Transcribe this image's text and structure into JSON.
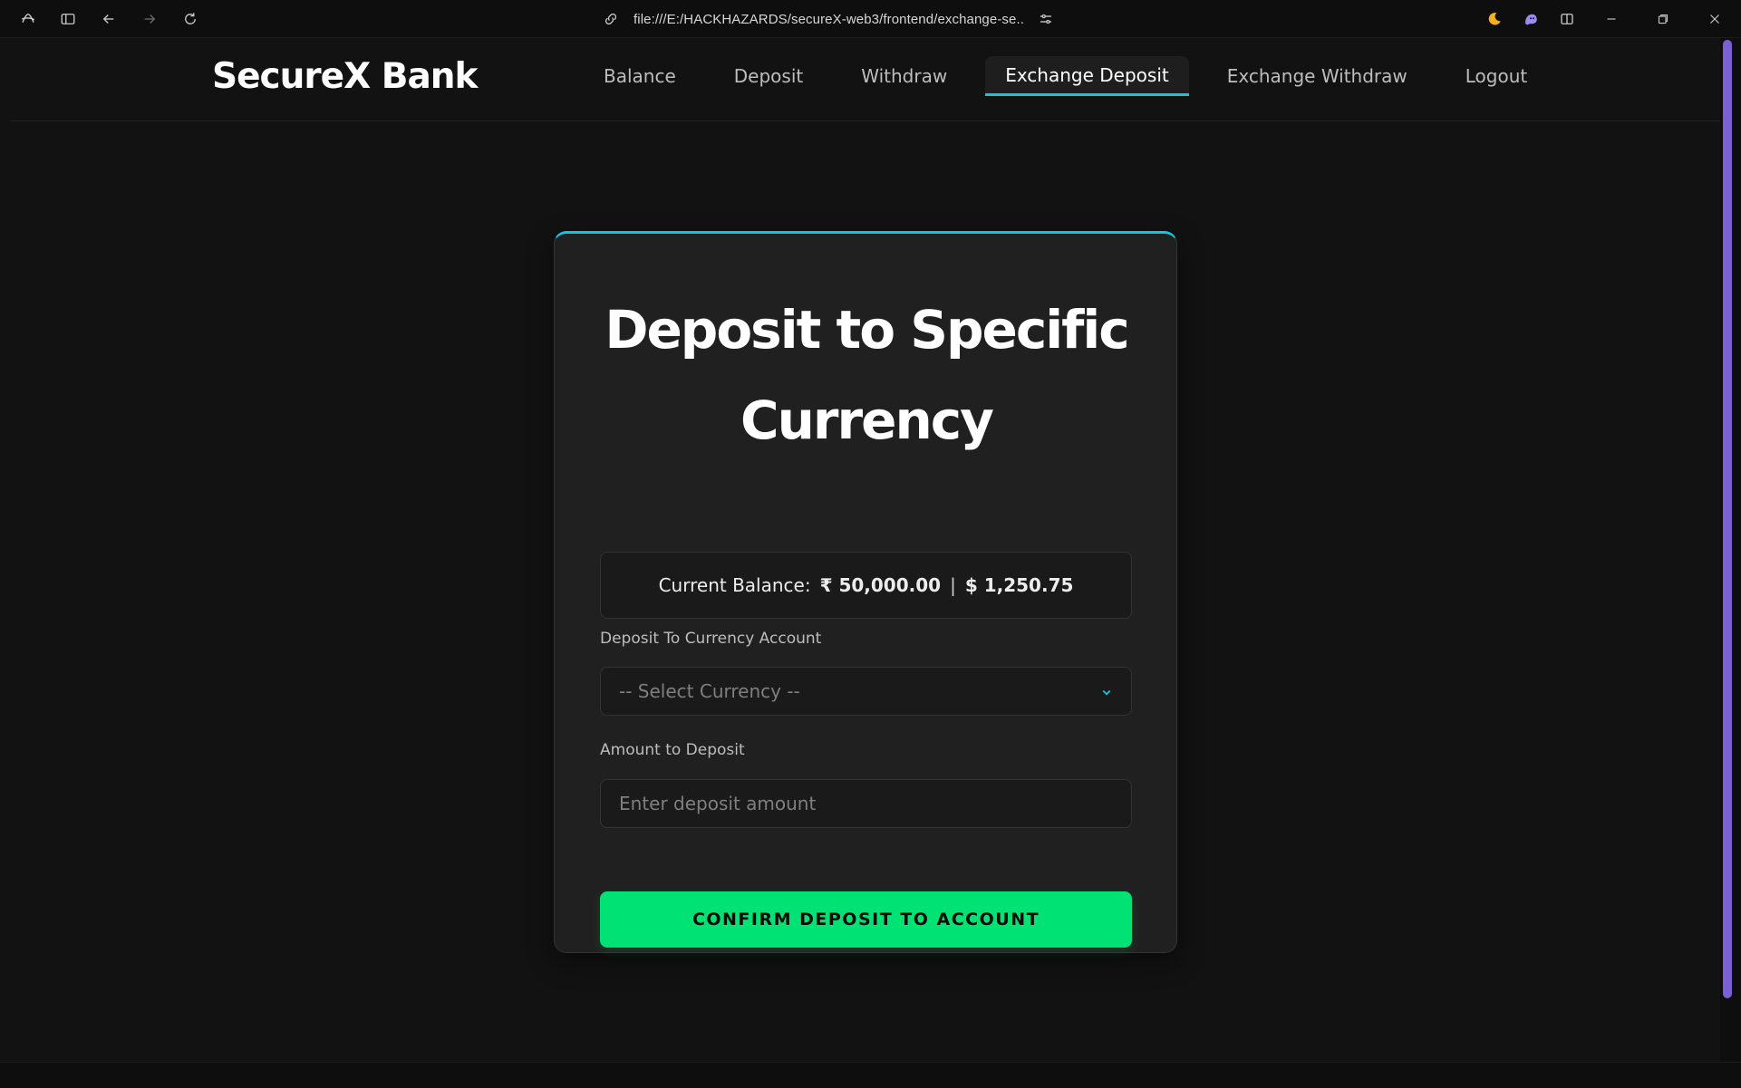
{
  "browser": {
    "url": "file:///E:/HACKHAZARDS/secureX-web3/frontend/exchange-se...",
    "icons": [
      "arc-logo-icon",
      "sidebar-icon",
      "back-icon",
      "forward-icon",
      "reload-icon",
      "link-icon",
      "site-settings-icon",
      "moon-icon",
      "ghost-extension-icon",
      "split-view-icon",
      "minimize-icon",
      "restore-icon",
      "close-icon"
    ]
  },
  "site": {
    "brand": "SecureX Bank",
    "nav": {
      "items": [
        {
          "label": "Balance",
          "active": false
        },
        {
          "label": "Deposit",
          "active": false
        },
        {
          "label": "Withdraw",
          "active": false
        },
        {
          "label": "Exchange Deposit",
          "active": true
        },
        {
          "label": "Exchange Withdraw",
          "active": false
        },
        {
          "label": "Logout",
          "active": false
        }
      ]
    }
  },
  "card": {
    "title": "Deposit to Specific Currency",
    "balance": {
      "label": "Current Balance:",
      "inr": "₹ 50,000.00",
      "separator": "|",
      "usd": "$ 1,250.75"
    },
    "currency_field": {
      "label": "Deposit To Currency Account",
      "selected": "-- Select Currency --"
    },
    "amount_field": {
      "label": "Amount to Deposit",
      "placeholder": "Enter deposit amount",
      "value": ""
    },
    "confirm_label": "CONFIRM DEPOSIT TO ACCOUNT"
  },
  "colors": {
    "accent": "#17c3e0",
    "button": "#00e374",
    "background": "#121212",
    "card": "#202020",
    "scrollbar": "#7b5fd6"
  }
}
